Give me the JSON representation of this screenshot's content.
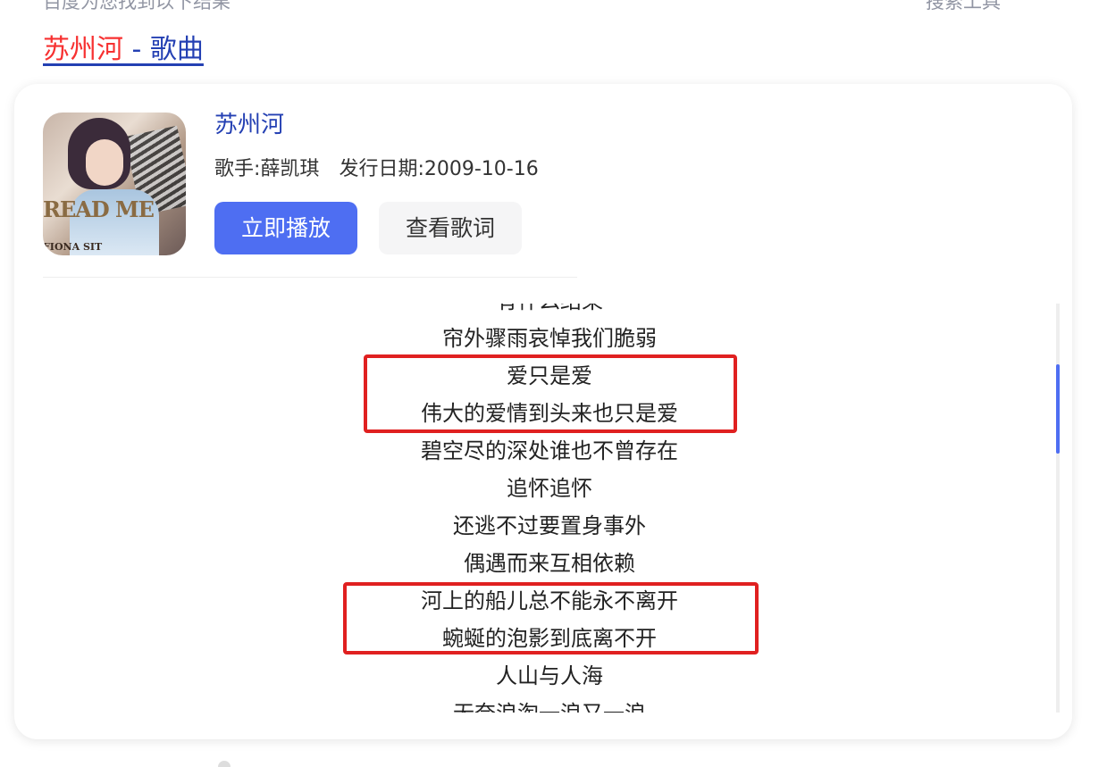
{
  "header": {
    "left_text": "百度为您找到以下结果",
    "right_text": "搜索工具"
  },
  "result": {
    "title_highlight": "苏州河",
    "title_rest": " - 歌曲"
  },
  "song": {
    "cover_text_main": "READ ME",
    "cover_text_artist": "FIONA SIT",
    "name": "苏州河",
    "singer_label": "歌手:",
    "singer": "薛凯琪",
    "release_label": "发行日期:",
    "release_date": "2009-10-16",
    "play_button": "立即播放",
    "lyrics_button": "查看歌词"
  },
  "lyrics": [
    "有什么结果",
    "帘外骤雨哀悼我们脆弱",
    "爱只是爱",
    "伟大的爱情到头来也只是爱",
    "碧空尽的深处谁也不曾存在",
    "追怀追怀",
    "还逃不过要置身事外",
    "偶遇而来互相依赖",
    "河上的船儿总不能永不离开",
    "蜿蜒的泡影到底离不开",
    "人山与人海",
    "无奈浪淘一浪又一浪"
  ],
  "colors": {
    "link": "#2440b3",
    "highlight": "#f73131",
    "primary_button": "#4e6ef2",
    "annotation": "#e02020"
  }
}
